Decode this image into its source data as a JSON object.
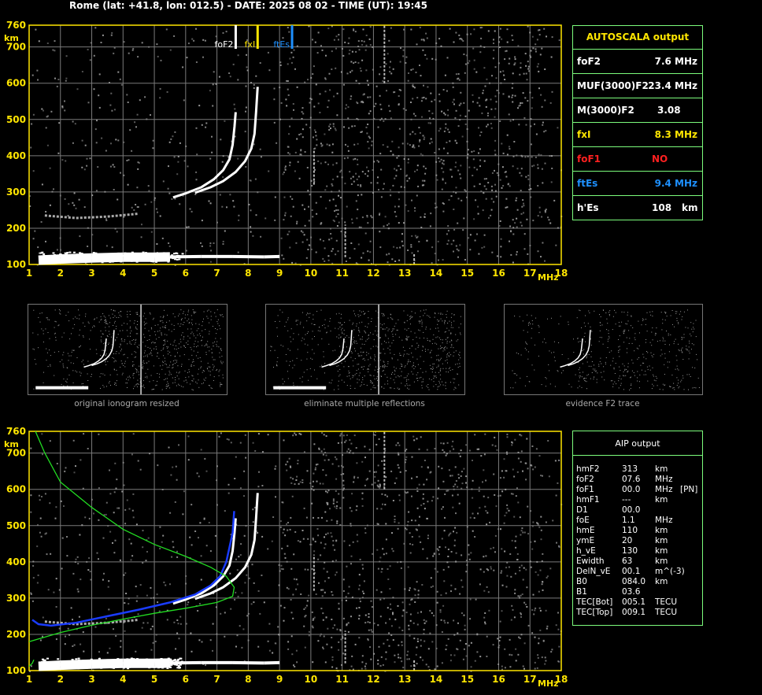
{
  "header": "Rome (lat: +41.8, lon: 012.5) - DATE: 2025 08 02 - TIME (UT): 19:45",
  "colors": {
    "axis": "#FFE600",
    "grid": "#7a7a7a",
    "noise": "#9a9a9a",
    "trace": "#ffffff",
    "foF2": "#ffffff",
    "fxI": "#FFE600",
    "ftEs": "#1E90FF",
    "foF1": "#FF2020",
    "model": "#22dd22",
    "profile": "#1a3cff",
    "box": "#7CFC7C"
  },
  "chart_data": [
    {
      "type": "scatter",
      "name": "ionogram",
      "xlabel": "MHz",
      "ylabel": "km",
      "xlim": [
        1,
        18
      ],
      "ylim": [
        100,
        760
      ],
      "x_ticks": [
        "1",
        "2",
        "3",
        "4",
        "5",
        "6",
        "7",
        "8",
        "9",
        "10",
        "11",
        "12",
        "13",
        "14",
        "15",
        "16",
        "17",
        "18"
      ],
      "y_ticks": [
        "100",
        "200",
        "300",
        "400",
        "500",
        "600",
        "700",
        "760"
      ],
      "markers": [
        {
          "label": "foF2",
          "freq": 7.6
        },
        {
          "label": "fxI",
          "freq": 8.3
        },
        {
          "label": "ftEs",
          "freq": 9.4
        }
      ],
      "traces": {
        "es_layer": [
          [
            1.3,
            112
          ],
          [
            2,
            115
          ],
          [
            3,
            118
          ],
          [
            4,
            120
          ],
          [
            5,
            120
          ],
          [
            5.5,
            121
          ],
          [
            6.5,
            122
          ],
          [
            7.5,
            122
          ],
          [
            8.5,
            121
          ],
          [
            9.0,
            122
          ]
        ],
        "f2_ordinary": [
          [
            5.6,
            285
          ],
          [
            6.0,
            296
          ],
          [
            6.5,
            313
          ],
          [
            6.9,
            335
          ],
          [
            7.2,
            360
          ],
          [
            7.4,
            390
          ],
          [
            7.5,
            430
          ],
          [
            7.56,
            480
          ],
          [
            7.6,
            520
          ]
        ],
        "f2_extraordinary": [
          [
            6.3,
            298
          ],
          [
            6.8,
            313
          ],
          [
            7.2,
            330
          ],
          [
            7.6,
            355
          ],
          [
            7.9,
            385
          ],
          [
            8.1,
            420
          ],
          [
            8.2,
            460
          ],
          [
            8.25,
            520
          ],
          [
            8.3,
            590
          ]
        ],
        "multiple_reflection": [
          [
            1.5,
            235
          ],
          [
            2.5,
            228
          ],
          [
            3.5,
            232
          ],
          [
            4.5,
            240
          ]
        ]
      }
    },
    {
      "type": "line",
      "name": "aip_profile",
      "xlabel": "MHz",
      "ylabel": "km",
      "xlim": [
        1,
        18
      ],
      "ylim": [
        100,
        760
      ],
      "x_ticks": [
        "1",
        "2",
        "3",
        "4",
        "5",
        "6",
        "7",
        "8",
        "9",
        "10",
        "11",
        "12",
        "13",
        "14",
        "15",
        "16",
        "17",
        "18"
      ],
      "y_ticks": [
        "100",
        "200",
        "300",
        "400",
        "500",
        "600",
        "700",
        "760"
      ],
      "series": [
        {
          "key": "true_height_profile",
          "color": "#1a3cff",
          "points": [
            [
              1.1,
              240
            ],
            [
              1.3,
              228
            ],
            [
              1.7,
              224
            ],
            [
              2.5,
              232
            ],
            [
              3.5,
              250
            ],
            [
              4.5,
              268
            ],
            [
              5.5,
              288
            ],
            [
              6.3,
              310
            ],
            [
              6.8,
              335
            ],
            [
              7.1,
              360
            ],
            [
              7.3,
              400
            ],
            [
              7.4,
              440
            ],
            [
              7.5,
              480
            ],
            [
              7.55,
              540
            ]
          ]
        },
        {
          "key": "model_top",
          "color": "#22dd22",
          "points": [
            [
              1.2,
              760
            ],
            [
              1.5,
              700
            ],
            [
              2,
              620
            ],
            [
              3,
              550
            ],
            [
              4,
              490
            ],
            [
              5,
              448
            ],
            [
              6,
              415
            ],
            [
              6.8,
              385
            ],
            [
              7.3,
              360
            ],
            [
              7.55,
              330
            ],
            [
              7.5,
              305
            ],
            [
              7.0,
              288
            ],
            [
              6.0,
              272
            ],
            [
              5.0,
              258
            ],
            [
              4.0,
              242
            ],
            [
              3.0,
              225
            ],
            [
              2.0,
              205
            ],
            [
              1.0,
              180
            ]
          ]
        },
        {
          "key": "model_bottom",
          "color": "#22dd22",
          "points": [
            [
              1.0,
              112
            ],
            [
              1.1,
              120
            ],
            [
              1.15,
              130
            ]
          ]
        }
      ]
    }
  ],
  "autoscala": {
    "title": "AUTOSCALA output",
    "rows": [
      {
        "label": "foF2",
        "value": "7.6 MHz",
        "color": "#ffffff"
      },
      {
        "label": "MUF(3000)F2",
        "value": "23.4 MHz",
        "color": "#ffffff"
      },
      {
        "label": "M(3000)F2",
        "value": "3.08",
        "color": "#ffffff"
      },
      {
        "label": "fxI",
        "value": "8.3 MHz",
        "color": "#FFE600"
      },
      {
        "label": "foF1",
        "value": "NO",
        "color": "#FF2020"
      },
      {
        "label": "ftEs",
        "value": "9.4 MHz",
        "color": "#1E90FF"
      },
      {
        "label": "h'Es",
        "value": "108",
        "unit": "km",
        "color": "#ffffff"
      }
    ]
  },
  "aip": {
    "title": "AIP output",
    "rows": [
      {
        "p": "hmF2",
        "v": "313",
        "u": "km"
      },
      {
        "p": "foF2",
        "v": "07.6",
        "u": "MHz"
      },
      {
        "p": "foF1",
        "v": "00.0",
        "u": "MHz",
        "x": "[PN]"
      },
      {
        "p": "hmF1",
        "v": "---",
        "u": "km"
      },
      {
        "p": "D1",
        "v": "00.0",
        "u": ""
      },
      {
        "p": "foE",
        "v": "1.1",
        "u": "MHz"
      },
      {
        "p": "hmE",
        "v": "110",
        "u": "km"
      },
      {
        "p": "ymE",
        "v": "20",
        "u": "km"
      },
      {
        "p": "h_vE",
        "v": "130",
        "u": "km"
      },
      {
        "p": "Ewidth",
        "v": "63",
        "u": "km"
      },
      {
        "p": "DelN_vE",
        "v": "00.1",
        "u": "m^(-3)"
      },
      {
        "p": "B0",
        "v": "084.0",
        "u": "km"
      },
      {
        "p": "B1",
        "v": "03.6",
        "u": ""
      },
      {
        "p": "TEC[Bot]",
        "v": "005.1",
        "u": "TECU"
      },
      {
        "p": "TEC[Top]",
        "v": "009.1",
        "u": "TECU"
      }
    ]
  },
  "thumbnails": [
    {
      "caption": "original ionogram resized"
    },
    {
      "caption": "eliminate multiple reflections"
    },
    {
      "caption": "evidence F2 trace"
    }
  ]
}
